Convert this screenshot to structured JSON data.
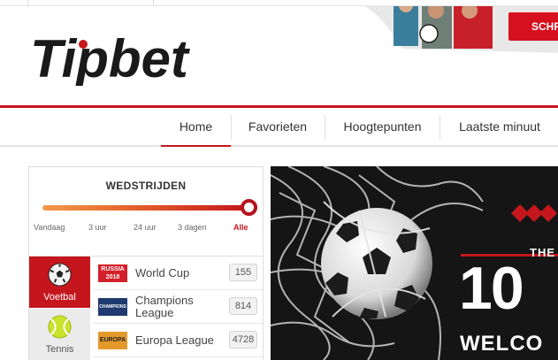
{
  "brand": {
    "logo_text": "Tipbet",
    "accent_color": "#c4161c"
  },
  "header": {
    "register_label": "SCHR"
  },
  "nav": {
    "items": [
      {
        "label": "Home",
        "active": true
      },
      {
        "label": "Favorieten",
        "active": false
      },
      {
        "label": "Hoogtepunten",
        "active": false
      },
      {
        "label": "Laatste minuut",
        "active": false
      }
    ]
  },
  "matches_panel": {
    "title": "WEDSTRIJDEN",
    "slider_value": "Alle",
    "time_filters": [
      "Vandaag",
      "3 uur",
      "24 uur",
      "3 dagen",
      "Alle"
    ],
    "sports": [
      {
        "label": "Voetbal",
        "icon": "football-icon",
        "active": true
      },
      {
        "label": "Tennis",
        "icon": "tennis-ball-icon",
        "active": false
      }
    ],
    "leagues": [
      {
        "name": "World Cup",
        "badge": "RUSSIA 2018",
        "count": "155"
      },
      {
        "name": "Champions League",
        "badge": "CHAMPIONS",
        "count": "814"
      },
      {
        "name": "Europa League",
        "badge": "EUROPA",
        "count": "4728"
      }
    ]
  },
  "banner": {
    "the": "THE",
    "big": "10",
    "welcome": "WELCO"
  }
}
